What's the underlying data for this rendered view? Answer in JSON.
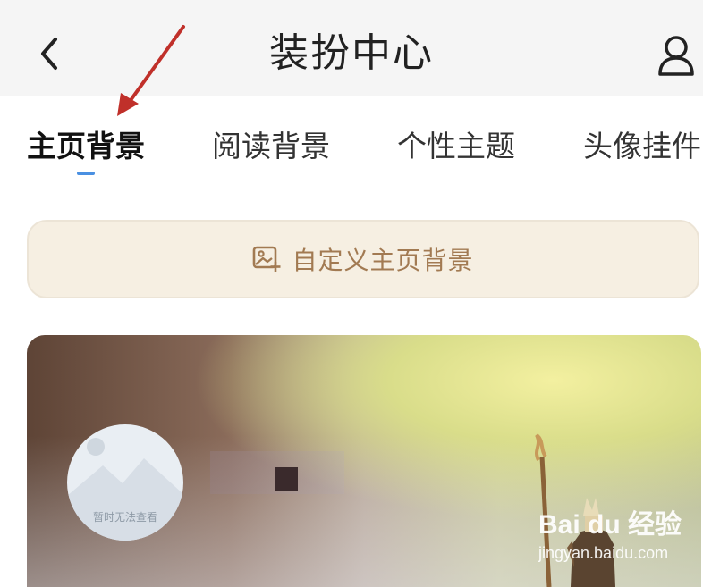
{
  "header": {
    "title": "装扮中心",
    "back_icon": "chevron-left-icon",
    "user_icon": "user-icon"
  },
  "tabs": [
    {
      "label": "主页背景",
      "active": true
    },
    {
      "label": "阅读背景",
      "active": false
    },
    {
      "label": "个性主题",
      "active": false
    },
    {
      "label": "头像挂件",
      "active": false
    }
  ],
  "custom_background": {
    "label": "自定义主页背景",
    "icon": "image-add-icon"
  },
  "banner": {
    "avatar_caption": "暂时无法查看"
  },
  "watermark": {
    "brand": "Bai du 经验",
    "url": "jingyan.baidu.com"
  },
  "colors": {
    "indicator": "#4a90e2",
    "custom_button_text": "#a27a52",
    "custom_button_bg": "#f6efe2",
    "annotation_arrow": "#c0302a"
  }
}
